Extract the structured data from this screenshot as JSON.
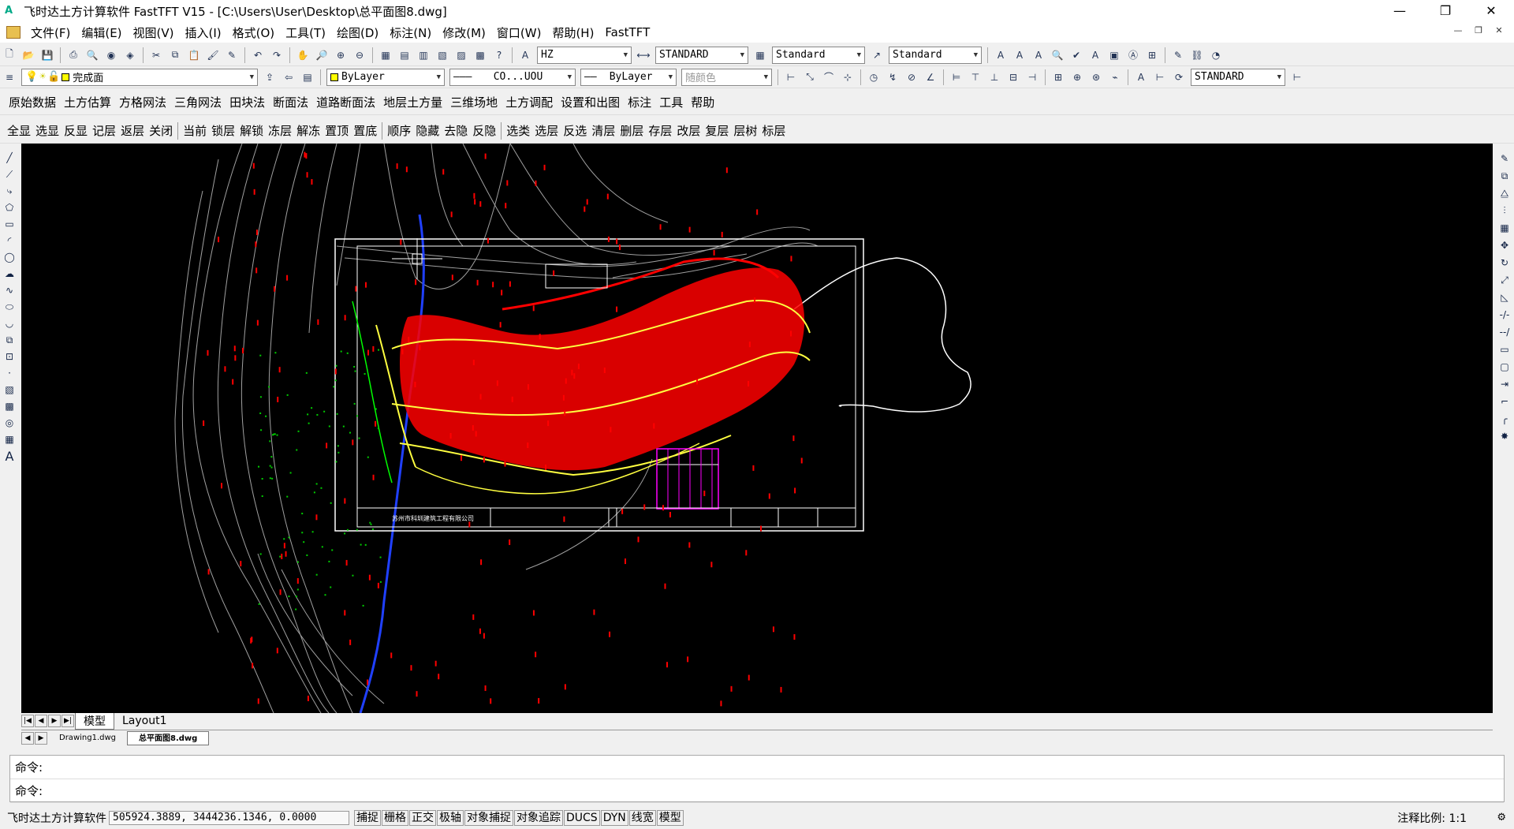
{
  "window": {
    "title": "飞时达土方计算软件 FastTFT V15 - [C:\\Users\\User\\Desktop\\总平面图8.dwg]",
    "minimize": "—",
    "restore": "❐",
    "close": "✕"
  },
  "menu": {
    "items": [
      "文件(F)",
      "编辑(E)",
      "视图(V)",
      "插入(I)",
      "格式(O)",
      "工具(T)",
      "绘图(D)",
      "标注(N)",
      "修改(M)",
      "窗口(W)",
      "帮助(H)",
      "FastTFT"
    ]
  },
  "toolbar1": {
    "textstyle": "HZ",
    "dimstyle": "STANDARD",
    "tablestyle": "Standard",
    "mleaderstyle": "Standard"
  },
  "toolbar2": {
    "layer": "完成面",
    "color": "ByLayer",
    "linetype": "CO...UOU",
    "lineweight": "ByLayer",
    "plotstyle": "随颜色",
    "textstyle2": "STANDARD"
  },
  "fastmenu": {
    "items": [
      "原始数据",
      "土方估算",
      "方格网法",
      "三角网法",
      "田块法",
      "断面法",
      "道路断面法",
      "地层土方量",
      "三维场地",
      "土方调配",
      "设置和出图",
      "标注",
      "工具",
      "帮助"
    ]
  },
  "layertools": {
    "group1": [
      "全显",
      "选显",
      "反显",
      "记层",
      "返层",
      "关闭"
    ],
    "group2": [
      "当前",
      "锁层",
      "解锁",
      "冻层",
      "解冻",
      "置顶",
      "置底"
    ],
    "group3": [
      "顺序",
      "隐藏",
      "去隐",
      "反隐"
    ],
    "group4": [
      "选类",
      "选层",
      "反选",
      "清层",
      "删层",
      "存层",
      "改层",
      "复层",
      "层树",
      "标层"
    ]
  },
  "tabs": {
    "model": "模型",
    "layout": "Layout1",
    "docs": [
      "Drawing1.dwg",
      "总平面图8.dwg"
    ]
  },
  "drawing": {
    "company": "苏州市科圳建筑工程有限公司"
  },
  "command": {
    "line1": "命令:",
    "line2": "命令:"
  },
  "status": {
    "appname": "飞时达土方计算软件",
    "coords": "505924.3889, 3444236.1346, 0.0000",
    "toggles": [
      "捕捉",
      "栅格",
      "正交",
      "极轴",
      "对象捕捉",
      "对象追踪",
      "DUCS",
      "DYN",
      "线宽",
      "模型"
    ],
    "annoscale": "注释比例: 1:1"
  },
  "colors": {
    "canvas": "#000000",
    "contour_red": "#ff0000",
    "contour_yellow": "#ffff40",
    "terrain_gray": "#a0a0a0",
    "river_blue": "#2040ff",
    "table_magenta": "#ff00ff"
  }
}
